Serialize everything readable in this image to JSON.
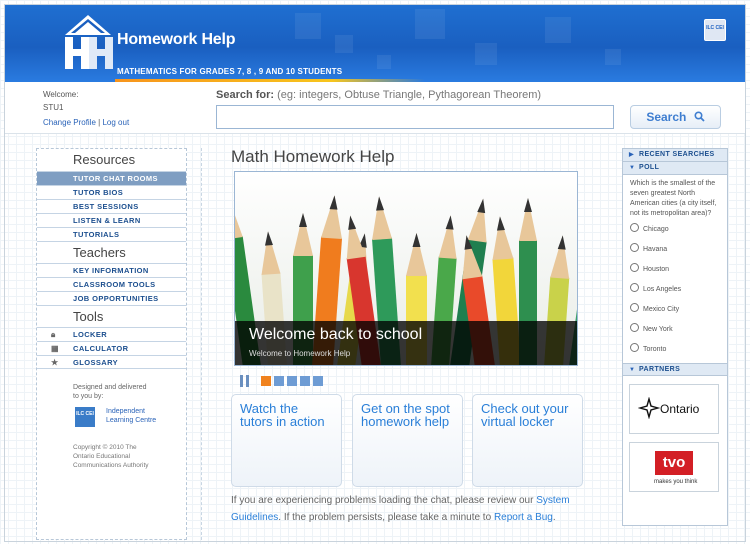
{
  "header": {
    "brand": "Homework Help",
    "tagline": "MATHEMATICS FOR GRADES 7, 8 , 9 AND 10 STUDENTS",
    "badge": "ILC CEI"
  },
  "user": {
    "welcome_label": "Welcome:",
    "username": "STU1",
    "change_profile": "Change Profile",
    "separator": "|",
    "logout": "Log out"
  },
  "search": {
    "label": "Search for:",
    "hint": "(eg: integers, Obtuse Triangle, Pythagorean Theorem)",
    "value": "",
    "button": "Search"
  },
  "sidebar": {
    "resources_heading": "Resources",
    "resources": [
      "TUTOR CHAT ROOMS",
      "TUTOR BIOS",
      "BEST SESSIONS",
      "LISTEN & LEARN",
      "TUTORIALS"
    ],
    "teachers_heading": "Teachers",
    "teachers": [
      "KEY INFORMATION",
      "CLASSROOM TOOLS",
      "JOB OPPORTUNITIES"
    ],
    "tools_heading": "Tools",
    "tools": [
      "LOCKER",
      "CALCULATOR",
      "GLOSSARY"
    ],
    "designed_by": "Designed and delivered to you by:",
    "ilc_name": "Independent Learning Centre",
    "ilc_badge": "ILC CEI",
    "copyright": "Copyright © 2010 The Ontario Educational Communications Authority"
  },
  "main": {
    "title": "Math Homework Help",
    "hero_title": "Welcome back to school",
    "hero_subtitle": "Welcome to Homework Help",
    "slides_count": 5,
    "active_slide": 1,
    "cards": [
      "Watch the tutors in action",
      "Get on the spot homework help",
      "Check out your virtual locker"
    ],
    "notice_pre": "If you are experiencing problems loading the chat, please review our ",
    "notice_link1": "System Guidelines",
    "notice_mid": ". If the problem persists, please take a minute to ",
    "notice_link2": "Report a Bug",
    "notice_end": "."
  },
  "right": {
    "recent_searches": "RECENT SEARCHES",
    "poll_heading": "POLL",
    "poll_question": "Which is the smallest of the seven greatest North American cities (a city itself, not its metropolitan area)?",
    "poll_options": [
      "Chicago",
      "Havana",
      "Houston",
      "Los Angeles",
      "Mexico City",
      "New York",
      "Toronto"
    ],
    "partners_heading": "PARTNERS",
    "partner1": "Ontario",
    "partner2_logo": "tvo",
    "partner2_tagline": "makes you think"
  },
  "colors": {
    "header_blue": "#1a5fc0",
    "accent_orange": "#f0821e",
    "link_blue": "#2a7fd8",
    "nav_active": "#7f9ec2"
  }
}
